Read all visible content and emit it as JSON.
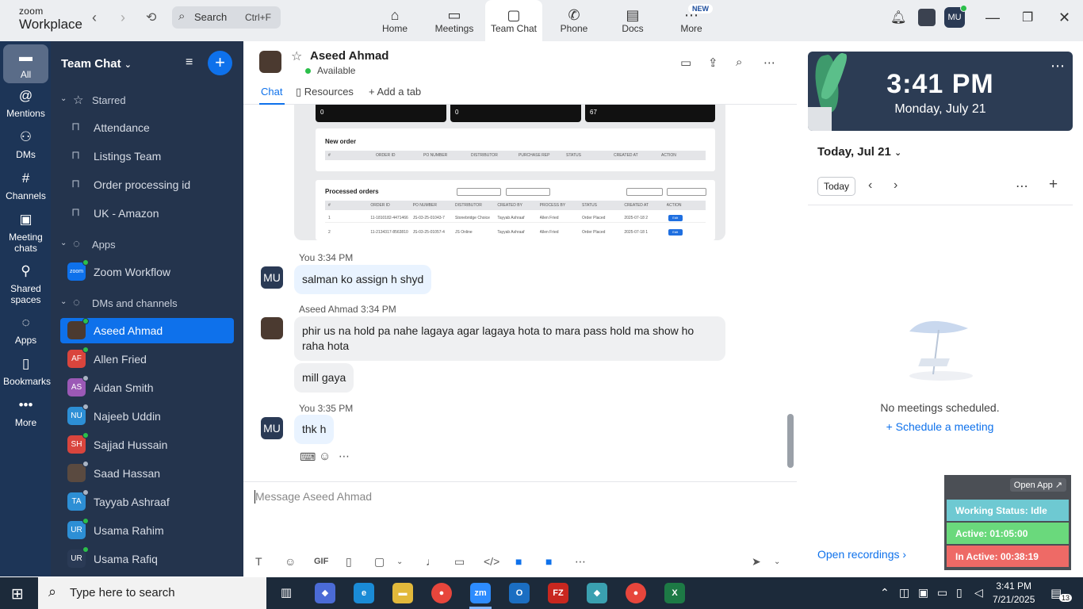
{
  "app": {
    "brand_line1": "zoom",
    "brand_line2": "Workplace"
  },
  "search": {
    "label": "Search",
    "shortcut": "Ctrl+F"
  },
  "top_tabs": [
    {
      "label": "Home",
      "icon": "home-icon"
    },
    {
      "label": "Meetings",
      "icon": "video-icon"
    },
    {
      "label": "Team Chat",
      "icon": "chat-icon"
    },
    {
      "label": "Phone",
      "icon": "phone-icon"
    },
    {
      "label": "Docs",
      "icon": "doc-icon"
    },
    {
      "label": "More",
      "icon": "more-icon"
    }
  ],
  "new_badge": "NEW",
  "user_initials": "MU",
  "rail": [
    {
      "label": "All"
    },
    {
      "label": "Mentions"
    },
    {
      "label": "DMs"
    },
    {
      "label": "Channels"
    },
    {
      "label": "Meeting chats"
    },
    {
      "label": "Shared spaces"
    },
    {
      "label": "Apps"
    },
    {
      "label": "Bookmarks"
    },
    {
      "label": "More"
    }
  ],
  "sidebar": {
    "title": "Team Chat",
    "starred_label": "Starred",
    "starred": [
      "Attendance",
      "Listings Team",
      "Order processing id",
      "UK - Amazon"
    ],
    "apps_label": "Apps",
    "apps": [
      "Zoom Workflow"
    ],
    "zoom_logo_text": "zoom",
    "dms_label": "DMs and channels",
    "dms": [
      {
        "name": "Aseed Ahmad",
        "initials": "",
        "color": "#4b3a30",
        "status": "#2bbf4a"
      },
      {
        "name": "Allen Fried",
        "initials": "AF",
        "color": "#d9453d",
        "status": "#2bbf4a"
      },
      {
        "name": "Aidan Smith",
        "initials": "AS",
        "color": "#9b59b6",
        "status": "#aab4c4"
      },
      {
        "name": "Najeeb Uddin",
        "initials": "NU",
        "color": "#2d8fd5",
        "status": "#aab4c4"
      },
      {
        "name": "Sajjad Hussain",
        "initials": "SH",
        "color": "#d9453d",
        "status": "#2bbf4a"
      },
      {
        "name": "Saad Hassan",
        "initials": "",
        "color": "#5a4a40",
        "status": "#aab4c4"
      },
      {
        "name": "Tayyab Ashraaf",
        "initials": "TA",
        "color": "#2d8fd5",
        "status": "#aab4c4"
      },
      {
        "name": "Usama Rahim",
        "initials": "UR",
        "color": "#2d8fd5",
        "status": "#2bbf4a"
      },
      {
        "name": "Usama Rafiq",
        "initials": "UR",
        "color": "#2a3a55",
        "status": "#2bbf4a"
      }
    ]
  },
  "chat": {
    "contact": "Aseed Ahmad",
    "status": "Available",
    "tabs": [
      "Chat",
      "Resources",
      "Add a tab"
    ],
    "screenshot": {
      "cards": [
        "0",
        "0",
        "67"
      ],
      "new_order_title": "New order",
      "new_order_cols": [
        "#",
        "ORDER ID",
        "PO NUMBER",
        "DISTRIBUTOR",
        "PURCHASE REP",
        "STATUS",
        "CREATED AT",
        "ACTION"
      ],
      "processed_title": "Processed orders",
      "processed_cols": [
        "#",
        "ORDER ID",
        "PO NUMBER",
        "DISTRIBUTOR",
        "CREATED BY",
        "PROCESS BY",
        "STATUS",
        "CREATED AT",
        "ACTION"
      ],
      "rows": [
        [
          "1",
          "11-1810182-4471466",
          "JS-03-25-01043-7",
          "Stonebridge Choice",
          "Tayyab Ashraaf",
          "Allen Fried",
          "Order Placed",
          "2025-07-18 2"
        ],
        [
          "2",
          "11-2134317-8563810",
          "JS-03-25-01057-4",
          "JS Online",
          "Tayyab Ashraaf",
          "Allen Fried",
          "Order Placed",
          "2025-07-18 1"
        ]
      ],
      "edit_label": "Edit"
    },
    "messages": [
      {
        "meta": "You 3:34 PM",
        "text": "salman ko assign h shyd"
      },
      {
        "meta": "Aseed Ahmad 3:34 PM",
        "text": "phir us na hold pa nahe lagaya agar lagaya hota to mara pass hold ma show ho raha hota"
      },
      {
        "meta": "",
        "text": "mill gaya"
      },
      {
        "meta": "You 3:35 PM",
        "text": "thk h"
      }
    ],
    "composer_placeholder": "Message Aseed Ahmad",
    "gif_label": "GIF"
  },
  "calendar": {
    "time": "3:41 PM",
    "date": "Monday, July 21",
    "day_selector": "Today, Jul 21",
    "today_button": "Today",
    "empty_text": "No meetings scheduled.",
    "schedule_link": "Schedule a meeting",
    "recordings_link": "Open recordings"
  },
  "widget": {
    "open_app": "Open App",
    "working": "Working Status: Idle",
    "active": "Active: 01:05:00",
    "inactive": "In Active: 00:38:19",
    "colors": {
      "working": "#6ec9d2",
      "active": "#6ad97c",
      "inactive": "#ee6a66"
    }
  },
  "taskbar": {
    "search_placeholder": "Type here to search",
    "time": "3:41 PM",
    "date": "7/21/2025",
    "notif_count": "13"
  }
}
